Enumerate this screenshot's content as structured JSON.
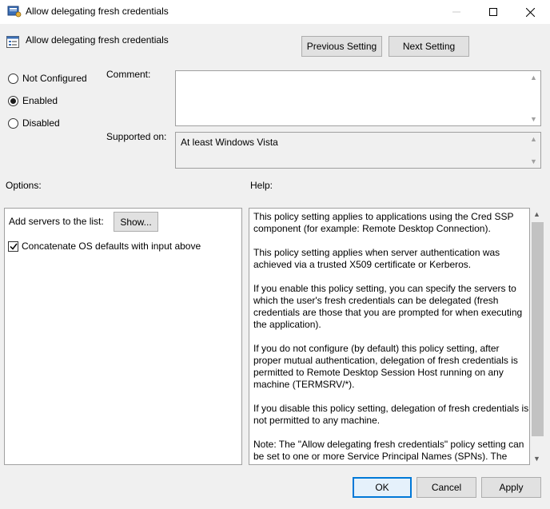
{
  "window": {
    "title": "Allow delegating fresh credentials"
  },
  "header": {
    "policy_title": "Allow delegating fresh credentials",
    "previous_label": "Previous Setting",
    "next_label": "Next Setting"
  },
  "state": {
    "options": [
      {
        "label": "Not Configured",
        "selected": false
      },
      {
        "label": "Enabled",
        "selected": true
      },
      {
        "label": "Disabled",
        "selected": false
      }
    ]
  },
  "comment": {
    "label": "Comment:",
    "value": ""
  },
  "supported": {
    "label": "Supported on:",
    "value": "At least Windows Vista"
  },
  "options_section": {
    "label": "Options:",
    "add_servers_label": "Add servers to the list:",
    "show_button": "Show...",
    "concatenate_label": "Concatenate OS defaults with input above",
    "concatenate_checked": true
  },
  "help_section": {
    "label": "Help:",
    "paragraphs": [
      "This policy setting applies to applications using the Cred SSP component (for example: Remote Desktop Connection).",
      "This policy setting applies when server authentication was achieved via a trusted X509 certificate or Kerberos.",
      "If you enable this policy setting, you can specify the servers to which the user's fresh credentials can be delegated (fresh credentials are those that you are prompted for when executing the application).",
      "If you do not configure (by default) this policy setting, after proper mutual authentication, delegation of fresh credentials is permitted to Remote Desktop Session Host running on any machine (TERMSRV/*).",
      "If you disable this policy setting, delegation of fresh credentials is not permitted to any machine.",
      "Note: The \"Allow delegating fresh credentials\" policy setting can be set to one or more Service Principal Names (SPNs). The SPN represents the target server to which the user credentials can be delegated."
    ]
  },
  "footer": {
    "ok_label": "OK",
    "cancel_label": "Cancel",
    "apply_label": "Apply"
  },
  "colors": {
    "dialog_bg": "#f0f0f0",
    "accent": "#0078d7"
  }
}
